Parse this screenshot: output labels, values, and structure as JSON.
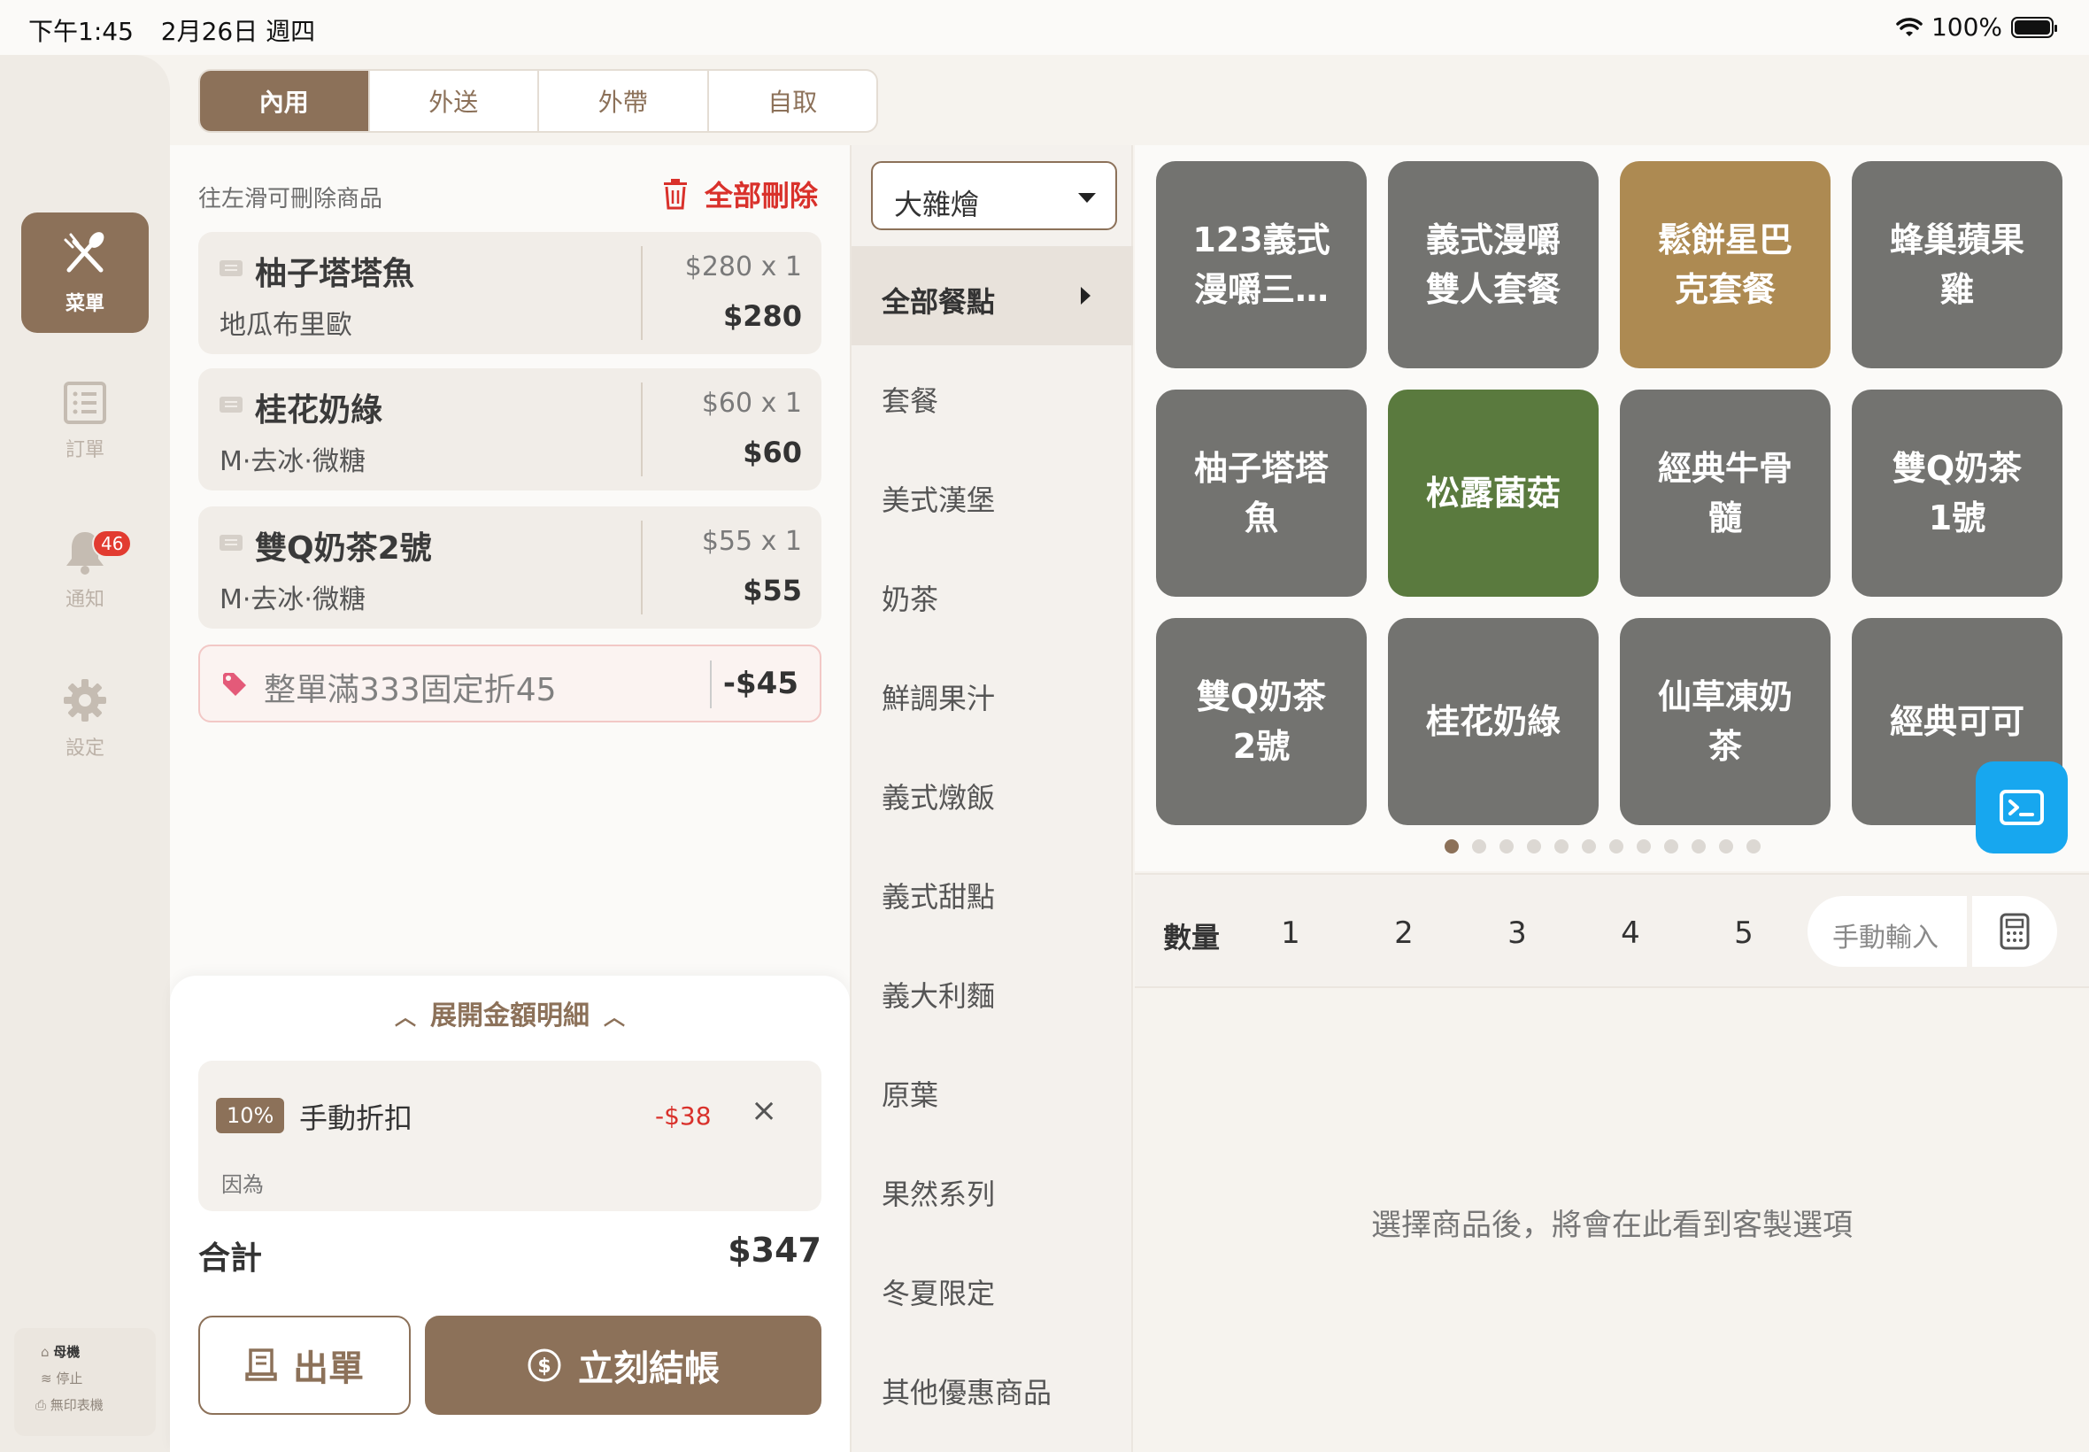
{
  "status_bar": {
    "time": "下午1:45",
    "date": "2月26日 週四",
    "battery": "100%"
  },
  "nav": {
    "items": [
      {
        "label": "菜單",
        "icon": "fork-knife-icon"
      },
      {
        "label": "訂單",
        "icon": "list-icon"
      },
      {
        "label": "通知",
        "icon": "bell-icon",
        "badge": "46"
      },
      {
        "label": "設定",
        "icon": "gear-icon"
      }
    ],
    "device": {
      "name": "母機",
      "status": "停止",
      "printer": "無印表機"
    }
  },
  "order_types": [
    "內用",
    "外送",
    "外帶",
    "自取"
  ],
  "cart": {
    "hint": "往左滑可刪除商品",
    "delete_all": "全部刪除",
    "items": [
      {
        "name": "柚子塔塔魚",
        "options": "地瓜布里歐",
        "qty": "$280 x 1",
        "subtotal": "$280"
      },
      {
        "name": "桂花奶綠",
        "options": "M·去冰·微糖",
        "qty": "$60 x 1",
        "subtotal": "$60"
      },
      {
        "name": "雙Q奶茶2號",
        "options": "M·去冰·微糖",
        "qty": "$55 x 1",
        "subtotal": "$55"
      }
    ],
    "promo": {
      "name": "整單滿333固定折45",
      "value": "-$45"
    }
  },
  "summary": {
    "expand_label": "展開金額明細",
    "discount": {
      "percent": "10%",
      "name": "手動折扣",
      "value": "-$38",
      "note": "因為"
    },
    "total_label": "合計",
    "total_value": "$347",
    "print_label": "出單",
    "pay_label": "立刻結帳"
  },
  "store_select": {
    "value": "大雜燴"
  },
  "categories": [
    "全部餐點",
    "套餐",
    "美式漢堡",
    "奶茶",
    "鮮調果汁",
    "義式燉飯",
    "義式甜點",
    "義大利麵",
    "原葉",
    "果然系列",
    "冬夏限定",
    "其他優惠商品"
  ],
  "products": [
    {
      "line1": "123義式",
      "line2": "漫嚼三…",
      "color": "#737370"
    },
    {
      "line1": "義式漫嚼",
      "line2": "雙人套餐",
      "color": "#737370"
    },
    {
      "line1": "鬆餅星巴",
      "line2": "克套餐",
      "color": "#ad8a52"
    },
    {
      "line1": "蜂巢蘋果",
      "line2": "雞",
      "color": "#737370"
    },
    {
      "line1": "柚子塔塔",
      "line2": "魚",
      "color": "#737370"
    },
    {
      "line1": "松露菌菇",
      "line2": "",
      "color": "#5a7a3e"
    },
    {
      "line1": "經典牛骨",
      "line2": "髓",
      "color": "#737370"
    },
    {
      "line1": "雙Q奶茶",
      "line2": "1號",
      "color": "#737370"
    },
    {
      "line1": "雙Q奶茶",
      "line2": "2號",
      "color": "#737370"
    },
    {
      "line1": "桂花奶綠",
      "line2": "",
      "color": "#737370"
    },
    {
      "line1": "仙草凍奶",
      "line2": "茶",
      "color": "#737370"
    },
    {
      "line1": "經典可可",
      "line2": "",
      "color": "#737370"
    }
  ],
  "pagination": {
    "pages": 12,
    "current": 1
  },
  "quantity": {
    "label": "數量",
    "options": [
      "1",
      "2",
      "3",
      "4",
      "5"
    ],
    "manual_placeholder": "手動輸入"
  },
  "custom_message": "選擇商品後，將會在此看到客製選項",
  "colors": {
    "brand": "#8c7159",
    "danger": "#d9312b",
    "fab": "#17a7ef"
  }
}
